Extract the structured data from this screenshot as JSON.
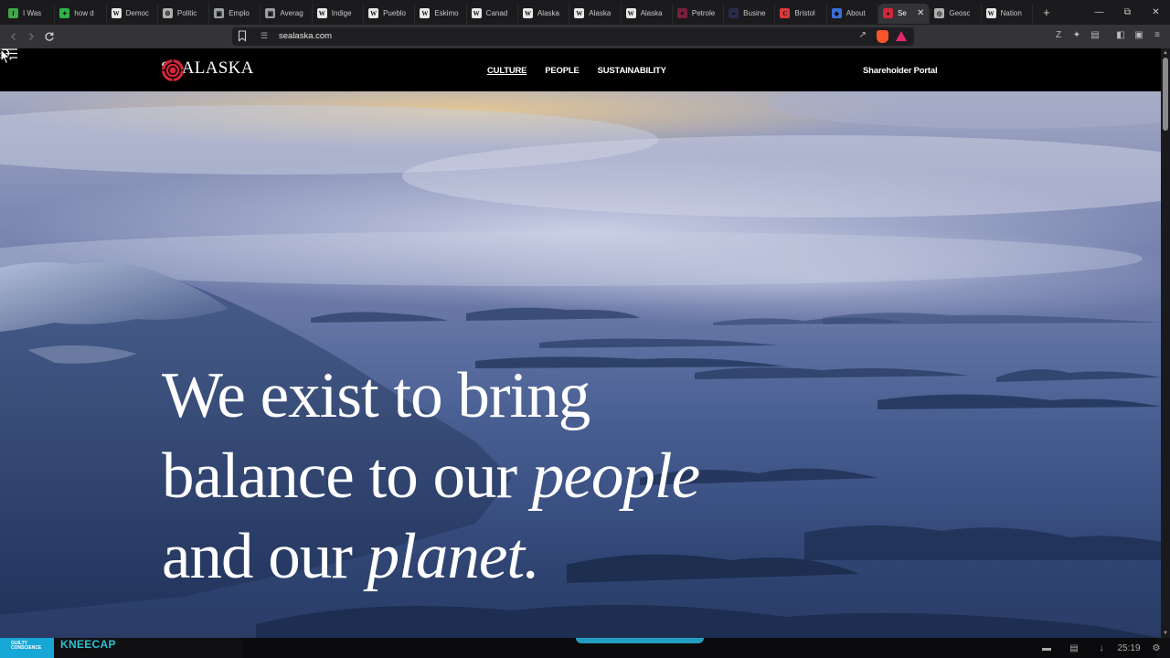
{
  "browser": {
    "tabs": [
      {
        "title": "I Was",
        "fav": "I",
        "fav_color": "#3ea84a"
      },
      {
        "title": "how d",
        "fav": "✦",
        "fav_color": "#2fb24a"
      },
      {
        "title": "Democ",
        "fav": "W",
        "fav_color": "#e8e8e8"
      },
      {
        "title": "Politic",
        "fav": "⚙",
        "fav_color": "#b0b0b0"
      },
      {
        "title": "Emplo",
        "fav": "▣",
        "fav_color": "#9aa0a6"
      },
      {
        "title": "Averag",
        "fav": "▣",
        "fav_color": "#9aa0a6"
      },
      {
        "title": "Indige",
        "fav": "W",
        "fav_color": "#e8e8e8"
      },
      {
        "title": "Pueblo",
        "fav": "W",
        "fav_color": "#e8e8e8"
      },
      {
        "title": "Eskimo",
        "fav": "W",
        "fav_color": "#e8e8e8"
      },
      {
        "title": "Canad",
        "fav": "W",
        "fav_color": "#e8e8e8"
      },
      {
        "title": "Alaska",
        "fav": "W",
        "fav_color": "#e8e8e8"
      },
      {
        "title": "Alaska",
        "fav": "W",
        "fav_color": "#e8e8e8"
      },
      {
        "title": "Alaska",
        "fav": "W",
        "fav_color": "#e8e8e8"
      },
      {
        "title": "Petrole",
        "fav": "✦",
        "fav_color": "#7a1f3d"
      },
      {
        "title": "Busine",
        "fav": "●",
        "fav_color": "#2a2a4a"
      },
      {
        "title": "Bristol",
        "fav": "C",
        "fav_color": "#d93a3a"
      },
      {
        "title": "About",
        "fav": "◆",
        "fav_color": "#3a6fd8"
      },
      {
        "title": "Se",
        "fav": "●",
        "fav_color": "#d3263a",
        "active": true,
        "close": "✕"
      },
      {
        "title": "Geosc",
        "fav": "◎",
        "fav_color": "#b0b0b0"
      },
      {
        "title": "Nation",
        "fav": "W",
        "fav_color": "#e8e8e8"
      }
    ],
    "new_tab": "+",
    "window_controls": {
      "minimize": "—",
      "restore": "⧉",
      "close": "✕"
    },
    "url": "sealaska.com",
    "icons": {
      "back": "chevron-left-icon",
      "forward": "chevron-right-icon",
      "reload": "reload-icon"
    }
  },
  "site": {
    "logo_text": "SEALASKA",
    "logo_color": "#d3263a",
    "nav": [
      "CULTURE",
      "PEOPLE",
      "SUSTAINABILITY"
    ],
    "portal": "Shareholder Portal",
    "hero": {
      "line1": "We exist to bring",
      "line2_plain": "balance to our ",
      "line2_em": "people",
      "line3_plain": "and our ",
      "line3_em": "planet."
    }
  },
  "taskbar": {
    "thumb_text": "GUILTY CONSCIENCE",
    "title": "KNEECAP",
    "clock": "25:19"
  }
}
